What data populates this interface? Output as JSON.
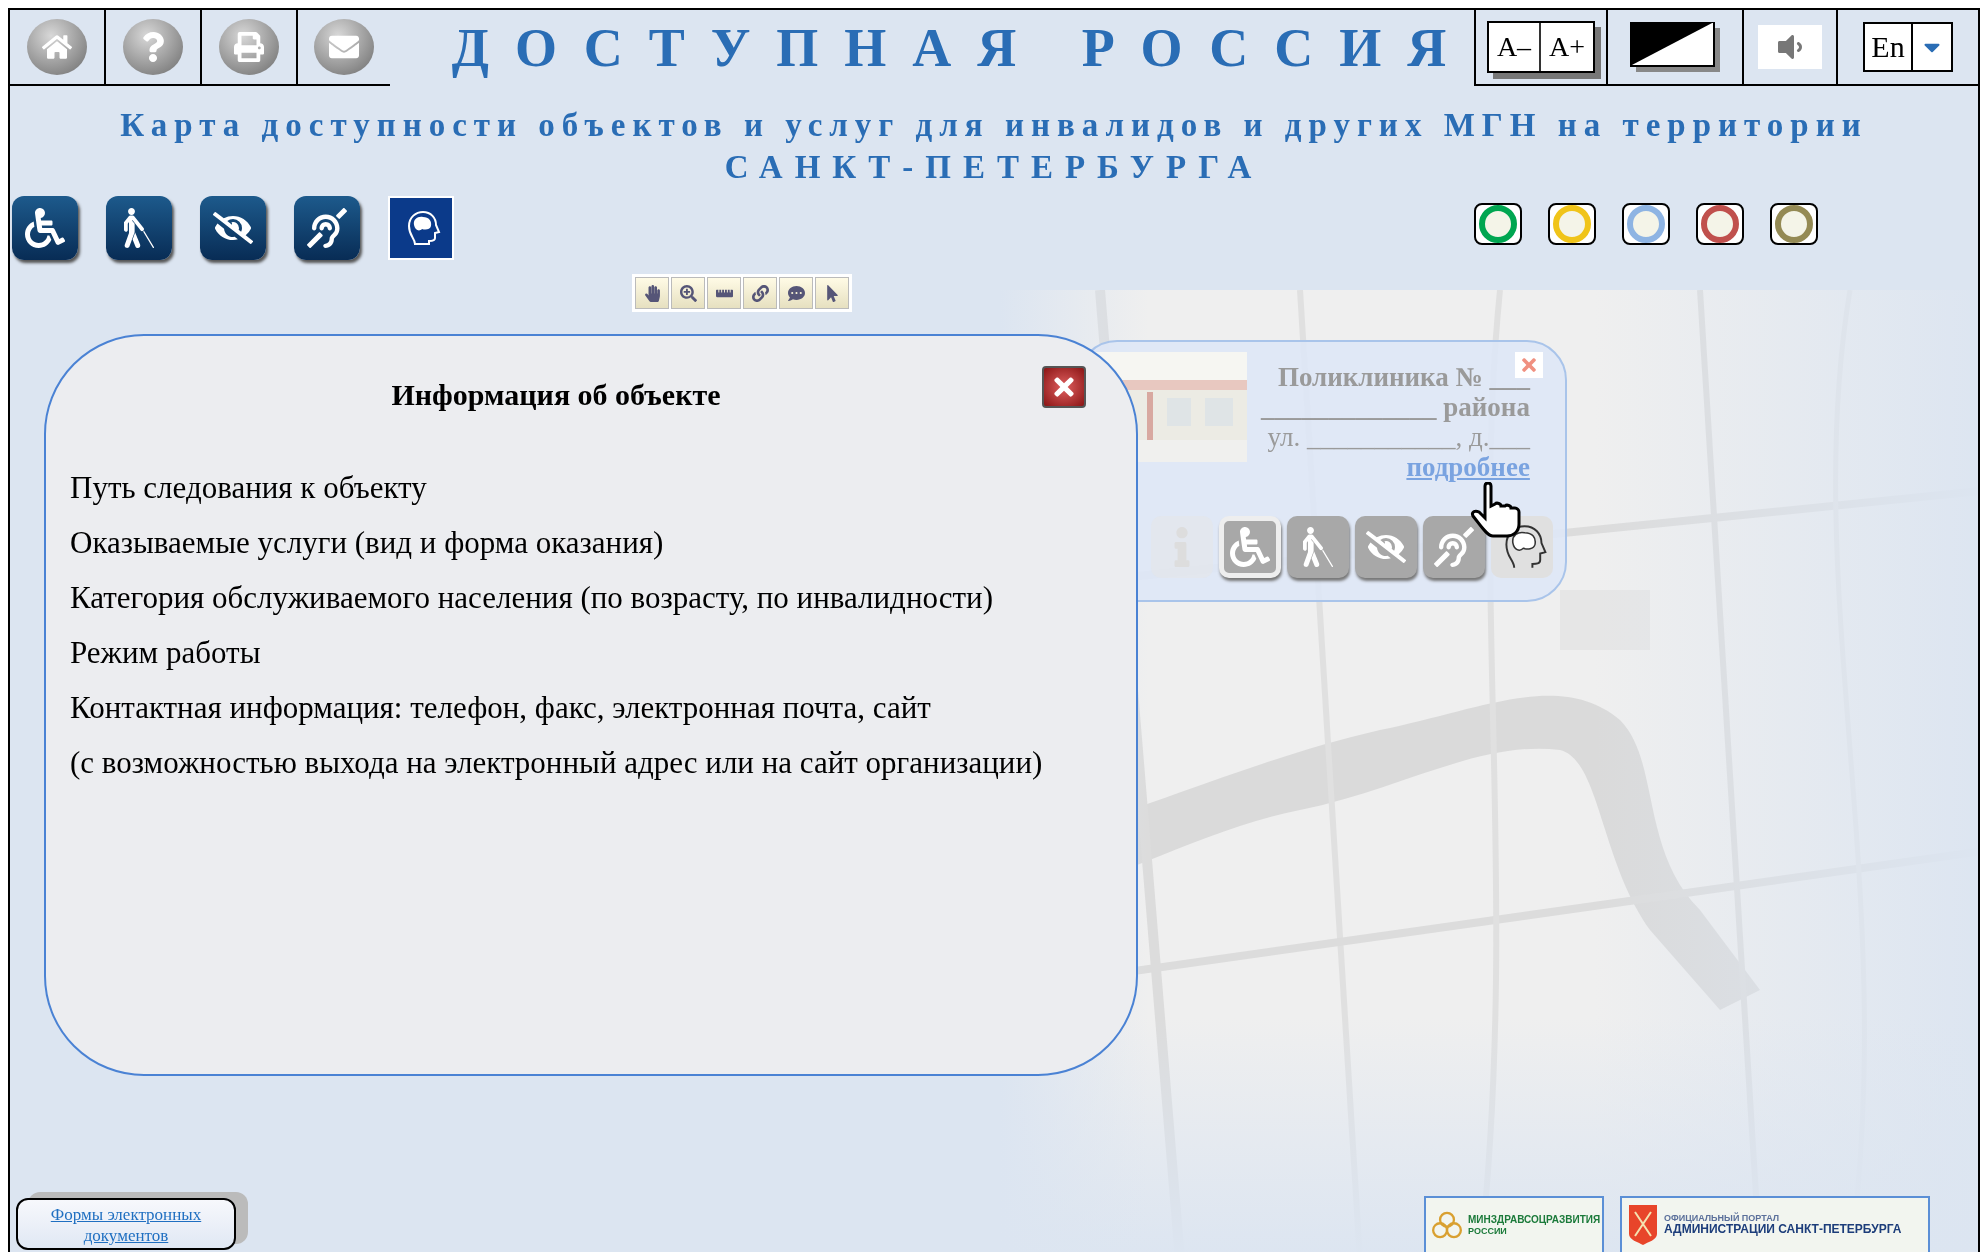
{
  "header": {
    "title": "ДОСТУПНАЯ РОССИЯ",
    "subtitle_lines": [
      "Карта доступности объектов и услуг для инвалидов и других МГН на территории",
      "САНКТ-ПЕТЕРБУРГА"
    ]
  },
  "font_buttons": [
    "A–",
    "A+"
  ],
  "language": {
    "value": "En"
  },
  "category_filters": [
    {
      "kind": "wheelchair",
      "selected": false
    },
    {
      "kind": "person",
      "selected": false
    },
    {
      "kind": "vision",
      "selected": false
    },
    {
      "kind": "hearing",
      "selected": false
    },
    {
      "kind": "mental",
      "selected": true
    }
  ],
  "status_filters": [
    {
      "color": "#00a651"
    },
    {
      "color": "#f0c419"
    },
    {
      "color": "#8eb4e3"
    },
    {
      "color": "#c0504d"
    },
    {
      "color": "#948a54"
    }
  ],
  "object_info_dialog": {
    "title": "Информация об объекте",
    "items": [
      "Путь следования к объекту",
      "Оказываемые услуги (вид и форма оказания)",
      "Категория обслуживаемого населения (по возрасту, по инвалидности)",
      "Режим работы",
      "Контактная информация: телефон, факс, электронная почта, сайт",
      "(с возможностью выхода на электронный адрес или на сайт организации)"
    ]
  },
  "object_popup": {
    "name_line": "Поликлиника № ___",
    "district_line": "_____________ района",
    "address_line": "ул. ___________, д.___",
    "details_link": "подробнее",
    "categories": [
      {
        "kind": "info"
      },
      {
        "kind": "wheelchair"
      },
      {
        "kind": "person"
      },
      {
        "kind": "vision"
      },
      {
        "kind": "hearing"
      },
      {
        "kind": "mental"
      }
    ]
  },
  "footer": {
    "documents_link": "Формы электронных документов",
    "logos": [
      {
        "kind": "ministry",
        "lines": [
          "МИНЗДРАВСОЦРАЗВИТИЯ",
          "РОССИИ"
        ]
      },
      {
        "kind": "portal",
        "lines": [
          "ОФИЦИАЛЬНЫЙ ПОРТАЛ",
          "АДМИНИСТРАЦИИ САНКТ-ПЕТЕРБУРГА"
        ]
      }
    ]
  }
}
